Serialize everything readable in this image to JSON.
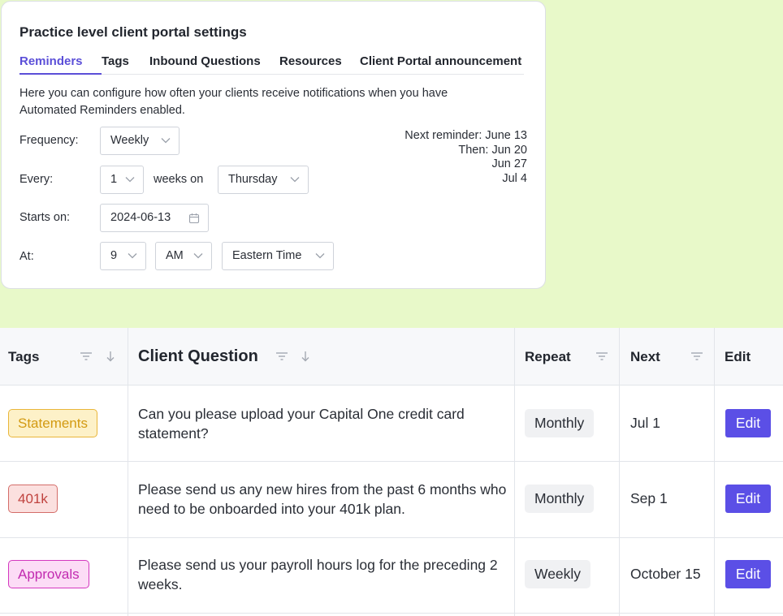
{
  "settings": {
    "title": "Practice level client portal settings",
    "tabs": [
      {
        "label": "Reminders",
        "active": true
      },
      {
        "label": "Tags"
      },
      {
        "label": "Inbound Questions"
      },
      {
        "label": "Resources"
      },
      {
        "label": "Client Portal announcement"
      }
    ],
    "description": "Here you can configure how often your clients receive notifications when you have Automated Reminders enabled.",
    "frequency": {
      "label": "Frequency:",
      "value": "Weekly"
    },
    "every": {
      "label": "Every:",
      "count": "1",
      "unit_text": "weeks on",
      "day": "Thursday"
    },
    "starts_on": {
      "label": "Starts on:",
      "value": "2024-06-13"
    },
    "at": {
      "label": "At:",
      "hour": "9",
      "meridiem": "AM",
      "timezone": "Eastern Time"
    },
    "next_reminders": {
      "line1": "Next reminder: June 13",
      "line2": "Then: Jun 20",
      "line3": "Jun 27",
      "line4": "Jul 4"
    }
  },
  "table": {
    "headers": {
      "tags": "Tags",
      "question": "Client Question",
      "repeat": "Repeat",
      "next": "Next",
      "edit": "Edit"
    },
    "rows": [
      {
        "tag": "Statements",
        "tag_color": "#e9b63a",
        "question": "Can you please upload your Capital One credit card statement?",
        "repeat": "Monthly",
        "next": "Jul 1",
        "edit": "Edit"
      },
      {
        "tag": "401k",
        "tag_color": "#d46d69",
        "question": "Please send us any new hires from the past 6 months who need to be onboarded into your 401k plan.",
        "repeat": "Monthly",
        "next": "Sep 1",
        "edit": "Edit"
      },
      {
        "tag": "Approvals",
        "tag_color": "#d437bf",
        "question": "Please send us your payroll hours log for the preceding 2 weeks.",
        "repeat": "Weekly",
        "next": "October 15",
        "edit": "Edit"
      }
    ]
  },
  "colors": {
    "accent": "#5b4fd8",
    "button": "#5b4fe6",
    "background": "#e8f9c9"
  },
  "icons": {
    "chevron": "chevron-down-icon",
    "calendar": "calendar-icon",
    "filter": "filter-icon",
    "sort": "sort-arrow-icon"
  }
}
